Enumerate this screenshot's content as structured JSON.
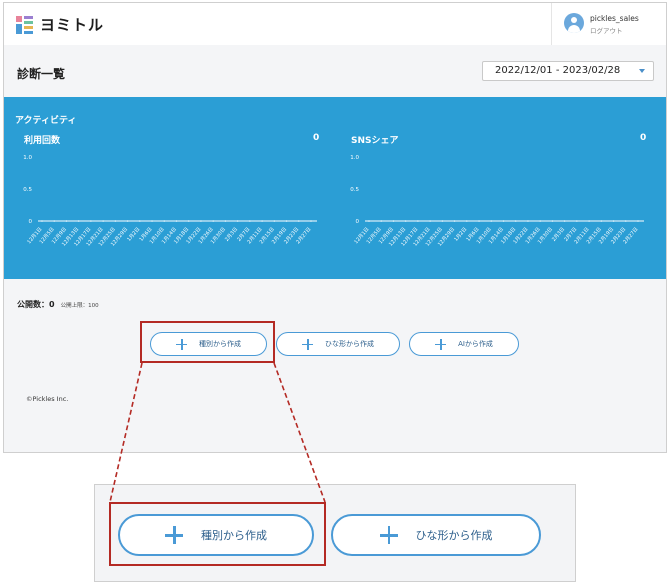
{
  "app": {
    "logo_text": "ヨミトル",
    "user_name": "pickles_sales",
    "logout_label": "ログアウト"
  },
  "page": {
    "title": "診断一覧",
    "date_range": "2022/12/01 - 2023/02/28"
  },
  "activity": {
    "title": "アクティビティ",
    "charts": [
      {
        "label": "利用回数",
        "total": "0",
        "chart_data": {
          "type": "line",
          "title": "利用回数",
          "ylim": [
            0,
            1.0
          ],
          "yticks": [
            "1.0",
            "0.5",
            "0"
          ],
          "categories": [
            "12月1日",
            "12月5日",
            "12月9日",
            "12月13日",
            "12月17日",
            "12月21日",
            "12月25日",
            "12月29日",
            "1月2日",
            "1月6日",
            "1月10日",
            "1月14日",
            "1月18日",
            "1月22日",
            "1月26日",
            "1月30日",
            "2月3日",
            "2月7日",
            "2月11日",
            "2月15日",
            "2月19日",
            "2月23日",
            "2月27日"
          ],
          "values": [
            0,
            0,
            0,
            0,
            0,
            0,
            0,
            0,
            0,
            0,
            0,
            0,
            0,
            0,
            0,
            0,
            0,
            0,
            0,
            0,
            0,
            0,
            0
          ]
        }
      },
      {
        "label": "SNSシェア",
        "total": "0",
        "chart_data": {
          "type": "line",
          "title": "SNSシェア",
          "ylim": [
            0,
            1.0
          ],
          "yticks": [
            "1.0",
            "0.5",
            "0"
          ],
          "categories": [
            "12月1日",
            "12月5日",
            "12月9日",
            "12月13日",
            "12月17日",
            "12月21日",
            "12月25日",
            "12月29日",
            "1月2日",
            "1月6日",
            "1月10日",
            "1月14日",
            "1月18日",
            "1月22日",
            "1月26日",
            "1月30日",
            "2月3日",
            "2月7日",
            "2月11日",
            "2月15日",
            "2月19日",
            "2月23日",
            "2月27日"
          ],
          "values": [
            0,
            0,
            0,
            0,
            0,
            0,
            0,
            0,
            0,
            0,
            0,
            0,
            0,
            0,
            0,
            0,
            0,
            0,
            0,
            0,
            0,
            0,
            0
          ]
        }
      }
    ]
  },
  "public_info": {
    "label": "公開数：0",
    "limit": "公開上限：100"
  },
  "create_buttons": [
    {
      "label": "種別から作成"
    },
    {
      "label": "ひな形から作成"
    },
    {
      "label": "AIから作成"
    }
  ],
  "footer": {
    "copyright": "©Pickles Inc."
  },
  "zoom": {
    "buttons": [
      {
        "label": "種別から作成"
      },
      {
        "label": "ひな形から作成"
      }
    ]
  },
  "colors": {
    "accent": "#2b9ed5",
    "highlight": "#b42a24",
    "button_border": "#4a9ad6"
  }
}
